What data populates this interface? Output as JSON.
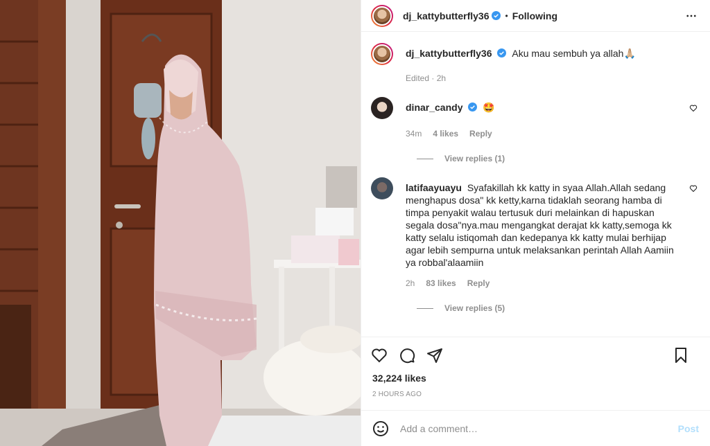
{
  "header": {
    "username": "dj_kattybutterfly36",
    "separator": "•",
    "follow_label": "Following"
  },
  "caption": {
    "username": "dj_kattybutterfly36",
    "text": "Aku mau sembuh ya allah🙏🏼",
    "edited": "Edited · 2h"
  },
  "comments": [
    {
      "username": "dinar_candy",
      "text": "🤩",
      "time": "34m",
      "likes": "4 likes",
      "reply": "Reply",
      "view_replies": "View replies (1)"
    },
    {
      "username": "latifaayuayu",
      "text": "Syafakillah kk katty in syaa Allah.Allah sedang menghapus dosa\" kk ketty,karna tidaklah seorang hamba di timpa penyakit walau tertusuk duri melainkan di hapuskan segala dosa\"nya.mau mengangkat derajat kk katty,semoga kk katty selalu istiqomah dan kedepanya kk katty mulai berhijap agar lebih sempurna untuk melaksankan perintah Allah Aamiin ya robbal'alaamiin",
      "time": "2h",
      "likes": "83 likes",
      "reply": "Reply",
      "view_replies": "View replies (5)"
    }
  ],
  "post": {
    "likes": "32,224 likes",
    "timestamp": "2 HOURS AGO"
  },
  "add_comment": {
    "placeholder": "Add a comment…",
    "post_label": "Post"
  },
  "icons": {
    "like": "heart-icon",
    "comment": "comment-icon",
    "share": "share-icon",
    "save": "bookmark-icon",
    "more": "more-horizontal-icon",
    "emoji": "emoji-icon",
    "verified": "verified-badge-icon"
  },
  "colors": {
    "verified": "#3897f0",
    "post_disabled": "#b2dffc",
    "muted": "#8e8e8e"
  }
}
